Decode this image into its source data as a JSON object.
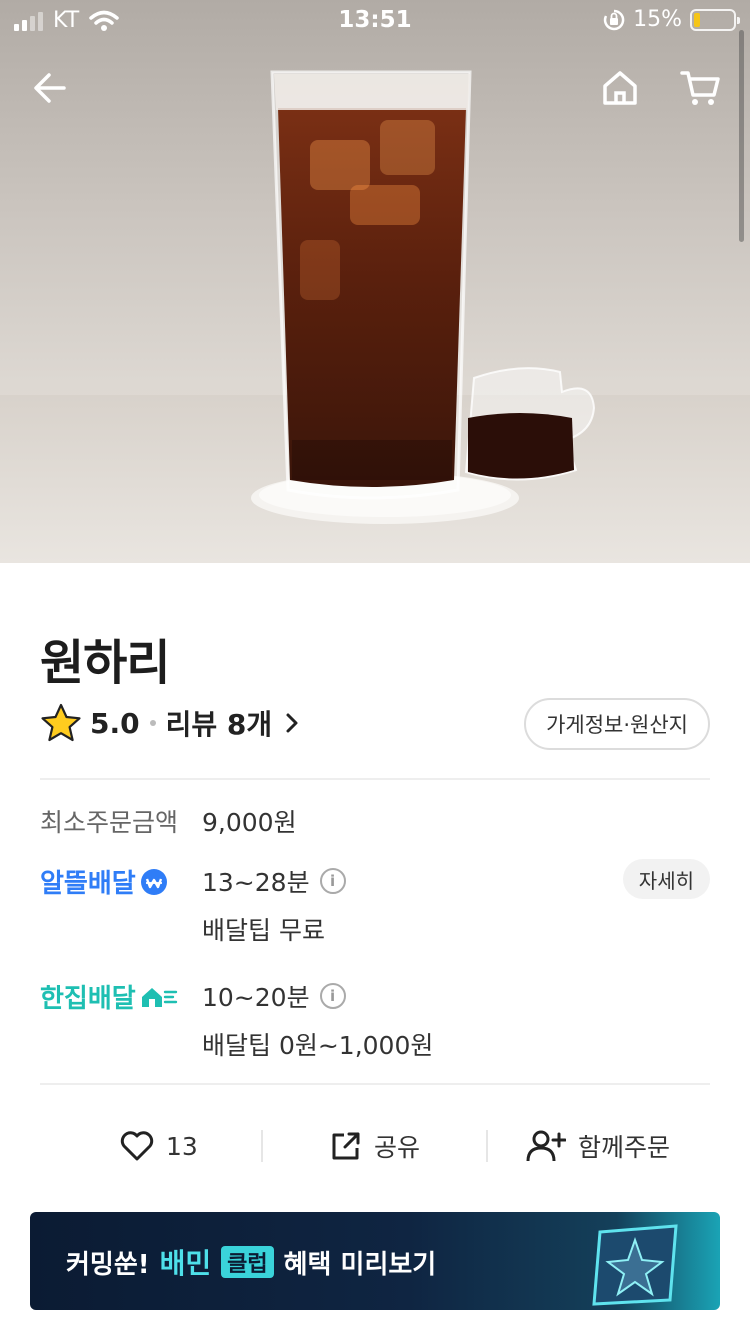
{
  "status_bar": {
    "carrier": "KT",
    "time": "13:51",
    "battery_percent": "15%",
    "battery_level": 0.15,
    "battery_color": "#f5c518"
  },
  "header": {
    "back_icon": "arrow-left-icon",
    "home_icon": "home-icon",
    "cart_icon": "cart-icon"
  },
  "store": {
    "name": "원하리",
    "rating": "5.0",
    "review_label": "리뷰 8개",
    "info_button": "가게정보·원산지"
  },
  "order_info": {
    "min_order_label": "최소주문금액",
    "min_order_value": "9,000원",
    "thrifty_delivery": {
      "brand": "알뜰배달",
      "time": "13~28분",
      "tip": "배달팁 무료",
      "detail_button": "자세히",
      "color": "#2f7df7"
    },
    "single_delivery": {
      "brand": "한집배달",
      "time": "10~20분",
      "tip": "배달팁 0원~1,000원",
      "color": "#1ebfb2"
    }
  },
  "actions": {
    "like_count": "13",
    "share_label": "공유",
    "group_order_label": "함께주문"
  },
  "banner": {
    "prefix": "커밍쑨!",
    "brand": "배민",
    "club": "클럽",
    "suffix": "혜택 미리보기"
  }
}
